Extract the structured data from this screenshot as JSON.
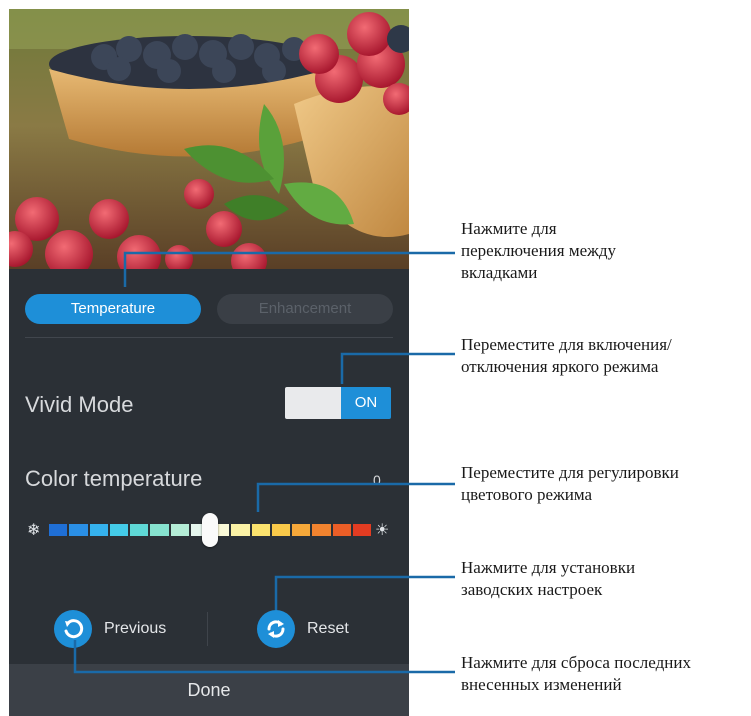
{
  "tabs": {
    "active": "Temperature",
    "inactive": "Enhancement"
  },
  "vivid_mode": {
    "label": "Vivid Mode",
    "toggle_state": "ON"
  },
  "color_temperature": {
    "label": "Color temperature",
    "value": "0",
    "slider_position": 0.5,
    "cold_icon": "snowflake-icon",
    "warm_icon": "sun-icon"
  },
  "actions": {
    "previous": "Previous",
    "previous_icon": "undo-icon",
    "reset": "Reset",
    "reset_icon": "refresh-icon",
    "done": "Done"
  },
  "callouts": {
    "tabs": "Нажмите для\nпереключения между\nвкладками",
    "vivid": "Переместите для включения/\nотключения яркого режима",
    "slider": "Переместите для регулировки\nцветового режима",
    "reset": "Нажмите для установки\nзаводских настроек",
    "previous": "Нажмите для сброса последних\nвнесенных изменений"
  },
  "colors": {
    "accent": "#1e8fd8",
    "screen_bg": "#2b3036",
    "callout_line": "#1a6aa8"
  }
}
